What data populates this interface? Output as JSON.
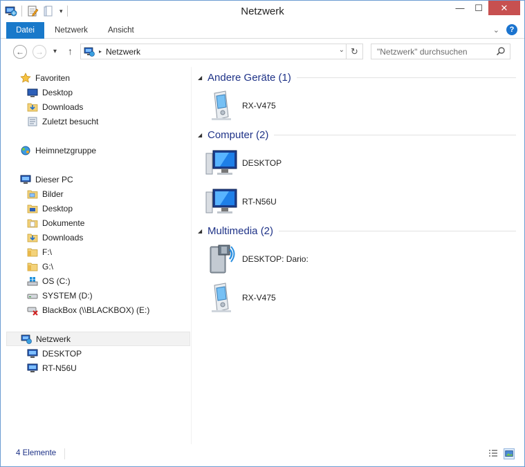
{
  "window": {
    "title": "Netzwerk"
  },
  "quick_access": {
    "dropdown_glyph": "▾"
  },
  "window_controls": {
    "minimize": "—",
    "maximize": "☐",
    "close": "✕"
  },
  "ribbon": {
    "tabs": [
      {
        "label": "Datei",
        "active": true
      },
      {
        "label": "Netzwerk"
      },
      {
        "label": "Ansicht"
      }
    ],
    "expand_glyph": "⌄",
    "help_glyph": "?"
  },
  "navigation": {
    "back_glyph": "←",
    "forward_glyph": "→",
    "recent_glyph": "▾",
    "up_glyph": "↑"
  },
  "address_bar": {
    "crumb_separator": "▸",
    "breadcrumb": "Netzwerk",
    "dropdown_glyph": "⌄",
    "refresh_glyph": "↻"
  },
  "search": {
    "placeholder": "\"Netzwerk\" durchsuchen"
  },
  "sidebar": {
    "favorites": {
      "label": "Favoriten",
      "items": [
        {
          "label": "Desktop",
          "icon": "desktop-icon"
        },
        {
          "label": "Downloads",
          "icon": "downloads-folder-icon"
        },
        {
          "label": "Zuletzt besucht",
          "icon": "recent-places-icon"
        }
      ]
    },
    "homegroup": {
      "label": "Heimnetzgruppe"
    },
    "this_pc": {
      "label": "Dieser PC",
      "items": [
        {
          "label": "Bilder",
          "icon": "pictures-folder-icon"
        },
        {
          "label": "Desktop",
          "icon": "desktop-folder-icon"
        },
        {
          "label": "Dokumente",
          "icon": "documents-folder-icon"
        },
        {
          "label": "Downloads",
          "icon": "downloads-folder-icon"
        },
        {
          "label": "F:\\",
          "icon": "folder-icon"
        },
        {
          "label": "G:\\",
          "icon": "folder-icon"
        },
        {
          "label": "OS (C:)",
          "icon": "windows-drive-icon"
        },
        {
          "label": "SYSTEM (D:)",
          "icon": "drive-icon"
        },
        {
          "label": "BlackBox (\\\\BLACKBOX) (E:)",
          "icon": "disconnected-network-drive-icon"
        }
      ]
    },
    "network": {
      "label": "Netzwerk",
      "selected": true,
      "items": [
        {
          "label": "DESKTOP",
          "icon": "computer-icon"
        },
        {
          "label": "RT-N56U",
          "icon": "computer-icon"
        }
      ]
    }
  },
  "content": {
    "groups": [
      {
        "title": "Andere Geräte (1)",
        "devices": [
          {
            "name": "RX-V475",
            "icon": "media-device-icon"
          }
        ]
      },
      {
        "title": "Computer (2)",
        "devices": [
          {
            "name": "DESKTOP",
            "icon": "computer-icon"
          },
          {
            "name": "RT-N56U",
            "icon": "computer-icon"
          }
        ]
      },
      {
        "title": "Multimedia (2)",
        "devices": [
          {
            "name": "DESKTOP: Dario:",
            "icon": "media-server-icon"
          },
          {
            "name": "RX-V475",
            "icon": "media-device-icon"
          }
        ]
      }
    ],
    "collapse_glyph": "◢"
  },
  "status_bar": {
    "item_count": "4 Elemente"
  },
  "colors": {
    "accent": "#1979ca",
    "close": "#c75050",
    "group_title": "#1e3287"
  }
}
